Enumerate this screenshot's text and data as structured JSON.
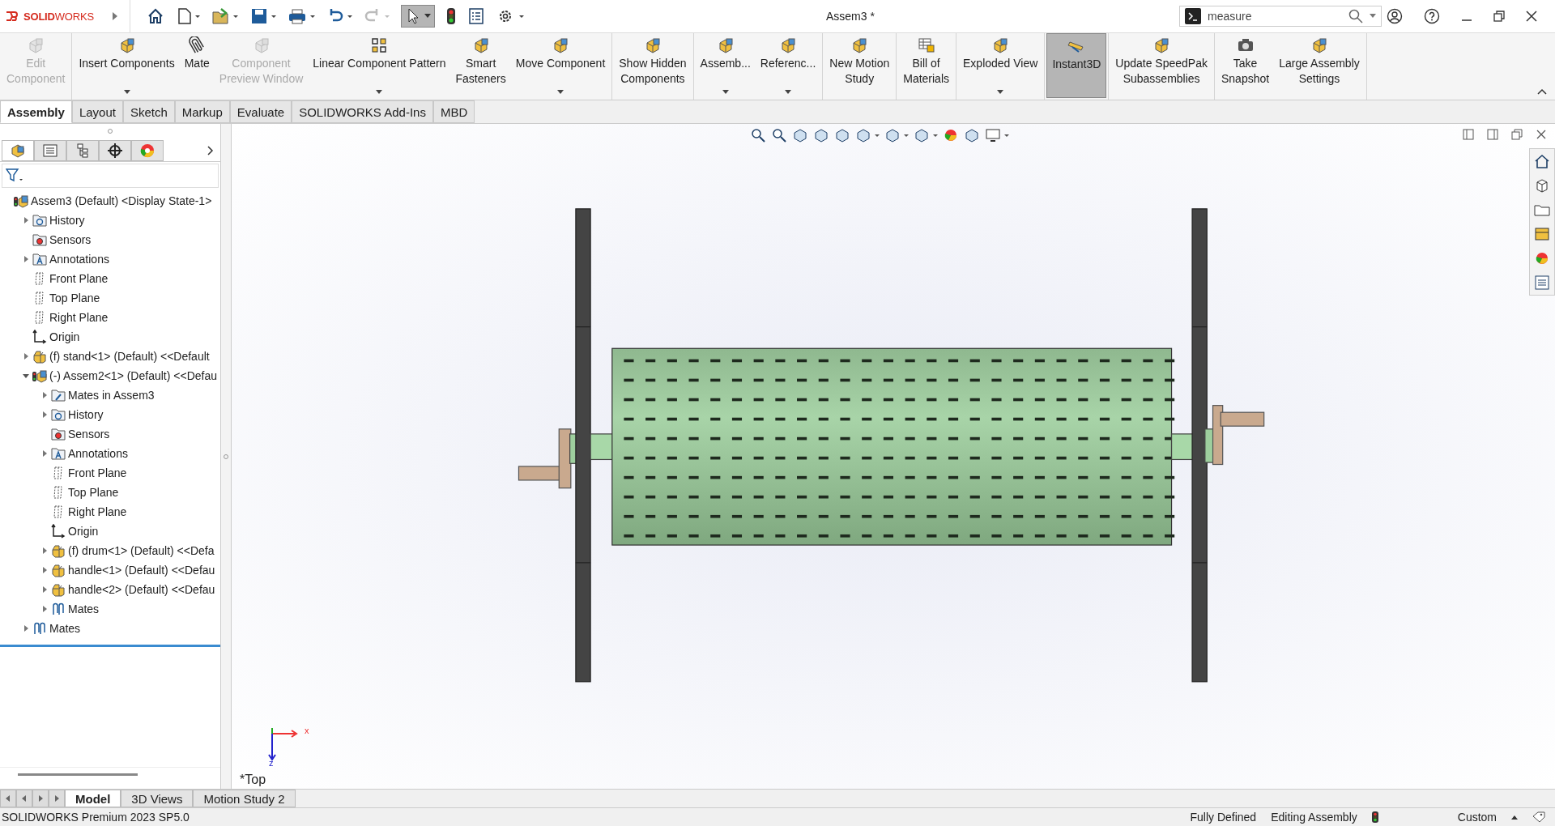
{
  "app": {
    "logo": "**SOLID**WORKS",
    "title": "Assem3 *",
    "search": {
      "value": "measure"
    }
  },
  "ribbon": {
    "groups": [
      [
        {
          "label": "Edit\nComponent",
          "disabled": true,
          "dropdown": false,
          "selected": false
        }
      ],
      [
        {
          "label": "Insert Components",
          "disabled": false,
          "dropdown": true,
          "selected": false
        },
        {
          "label": "Mate",
          "disabled": false,
          "dropdown": false,
          "selected": false
        },
        {
          "label": "Component\nPreview Window",
          "disabled": true,
          "dropdown": false,
          "selected": false
        },
        {
          "label": "Linear Component Pattern",
          "disabled": false,
          "dropdown": true,
          "selected": false
        },
        {
          "label": "Smart\nFasteners",
          "disabled": false,
          "dropdown": false,
          "selected": false
        },
        {
          "label": "Move Component",
          "disabled": false,
          "dropdown": true,
          "selected": false
        }
      ],
      [
        {
          "label": "Show Hidden\nComponents",
          "disabled": false,
          "dropdown": false,
          "selected": false
        }
      ],
      [
        {
          "label": "Assemb...",
          "disabled": false,
          "dropdown": true,
          "selected": false
        },
        {
          "label": "Referenc...",
          "disabled": false,
          "dropdown": true,
          "selected": false
        }
      ],
      [
        {
          "label": "New Motion\nStudy",
          "disabled": false,
          "dropdown": false,
          "selected": false
        }
      ],
      [
        {
          "label": "Bill of\nMaterials",
          "disabled": false,
          "dropdown": false,
          "selected": false
        }
      ],
      [
        {
          "label": "Exploded View",
          "disabled": false,
          "dropdown": true,
          "selected": false
        }
      ],
      [
        {
          "label": "Instant3D",
          "disabled": false,
          "dropdown": false,
          "selected": true
        }
      ],
      [
        {
          "label": "Update SpeedPak\nSubassemblies",
          "disabled": false,
          "dropdown": false,
          "selected": false
        }
      ],
      [
        {
          "label": "Take\nSnapshot",
          "disabled": false,
          "dropdown": false,
          "selected": false
        },
        {
          "label": "Large Assembly\nSettings",
          "disabled": false,
          "dropdown": false,
          "selected": false
        }
      ]
    ]
  },
  "command_tabs": [
    {
      "label": "Assembly",
      "selected": true
    },
    {
      "label": "Layout",
      "selected": false
    },
    {
      "label": "Sketch",
      "selected": false
    },
    {
      "label": "Markup",
      "selected": false
    },
    {
      "label": "Evaluate",
      "selected": false
    },
    {
      "label": "SOLIDWORKS Add-Ins",
      "selected": false
    },
    {
      "label": "MBD",
      "selected": false
    }
  ],
  "tree": [
    {
      "label": "Assem3 (Default) <Display State-1>",
      "kind": "assembly",
      "children": [
        {
          "label": "History",
          "kind": "history",
          "expanded": false
        },
        {
          "label": "Sensors",
          "kind": "sensors"
        },
        {
          "label": "Annotations",
          "kind": "annotations",
          "expanded": false
        },
        {
          "label": "Front Plane",
          "kind": "plane"
        },
        {
          "label": "Top Plane",
          "kind": "plane"
        },
        {
          "label": "Right Plane",
          "kind": "plane"
        },
        {
          "label": "Origin",
          "kind": "origin"
        },
        {
          "label": "(f) stand<1> (Default) <<Default",
          "kind": "part",
          "expanded": false
        },
        {
          "label": "(-) Assem2<1> (Default) <<Defau",
          "kind": "assembly",
          "expanded": true,
          "children": [
            {
              "label": "Mates in Assem3",
              "kind": "mates-folder",
              "expanded": false
            },
            {
              "label": "History",
              "kind": "history",
              "expanded": false
            },
            {
              "label": "Sensors",
              "kind": "sensors"
            },
            {
              "label": "Annotations",
              "kind": "annotations",
              "expanded": false
            },
            {
              "label": "Front Plane",
              "kind": "plane"
            },
            {
              "label": "Top Plane",
              "kind": "plane"
            },
            {
              "label": "Right Plane",
              "kind": "plane"
            },
            {
              "label": "Origin",
              "kind": "origin"
            },
            {
              "label": "(f) drum<1> (Default) <<Defa",
              "kind": "part",
              "expanded": false
            },
            {
              "label": "handle<1> (Default) <<Defau",
              "kind": "part",
              "expanded": false
            },
            {
              "label": "handle<2> (Default) <<Defau",
              "kind": "part",
              "expanded": false
            },
            {
              "label": "Mates",
              "kind": "mates",
              "expanded": false
            }
          ]
        },
        {
          "label": "Mates",
          "kind": "mates",
          "expanded": false
        }
      ]
    }
  ],
  "viewport": {
    "view_name": "*Top",
    "triad": {
      "x": "x",
      "z": "z"
    }
  },
  "bottom_tabs": [
    {
      "label": "Model",
      "selected": true
    },
    {
      "label": "3D Views",
      "selected": false
    },
    {
      "label": "Motion Study 2",
      "selected": false
    }
  ],
  "status_bar": {
    "product": "SOLIDWORKS Premium 2023 SP5.0",
    "state": "Fully Defined",
    "mode": "Editing Assembly",
    "units": "Custom"
  }
}
